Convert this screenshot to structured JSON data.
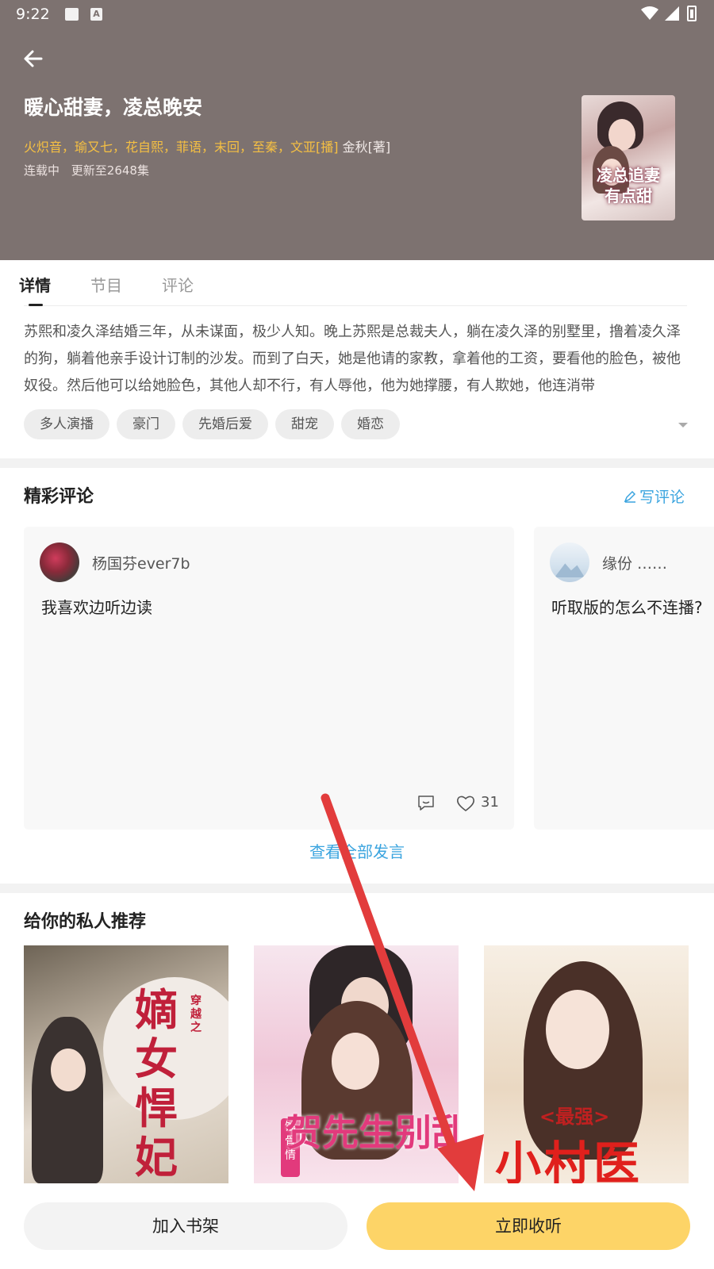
{
  "status_bar": {
    "time": "9:22",
    "notif_a": "A"
  },
  "book": {
    "title": "暖心甜妻，凌总晚安",
    "casts": "火炽音，瑜又七，花自熙，菲语，末回，至秦，文亚[播]",
    "author": "金秋[著]",
    "status": "连载中",
    "update": "更新至2648集",
    "cover_title_line1": "凌总追妻",
    "cover_title_line2": "有点甜"
  },
  "tabs": [
    "详情",
    "节目",
    "评论"
  ],
  "synopsis": "苏熙和凌久泽结婚三年，从未谋面，极少人知。晚上苏熙是总裁夫人，躺在凌久泽的别墅里，撸着凌久泽的狗，躺着他亲手设计订制的沙发。而到了白天，她是他请的家教，拿着他的工资，要看他的脸色，被他奴役。然后他可以给她脸色，其他人却不行，有人辱他，他为她撑腰，有人欺她，他连消带",
  "tags": [
    "多人演播",
    "豪门",
    "先婚后爱",
    "甜宠",
    "婚恋"
  ],
  "comments": {
    "title": "精彩评论",
    "write_label": "写评论",
    "items": [
      {
        "username": "杨国芬ever7b",
        "text": "我喜欢边听边读",
        "likes": "31"
      },
      {
        "username": "缘份 ……",
        "text": "听取版的怎么不连播?"
      }
    ],
    "view_all": "查看全部发言"
  },
  "recommend": {
    "title": "给你的私人推荐",
    "items": [
      {
        "cover_text": "嫡女悍妃",
        "cover_sub": "穿越之"
      },
      {
        "cover_text": "贺先生别乱来",
        "cover_sub": "蚀骨情"
      },
      {
        "cover_text": "小村医",
        "cover_sub": "<最强>"
      }
    ]
  },
  "bottom": {
    "add_shelf": "加入书架",
    "listen_now": "立即收听"
  },
  "colors": {
    "header_bg": "#7d7270",
    "accent_yellow": "#fdd467",
    "link_blue": "#3aa4df",
    "cast_orange": "#f6c042"
  }
}
